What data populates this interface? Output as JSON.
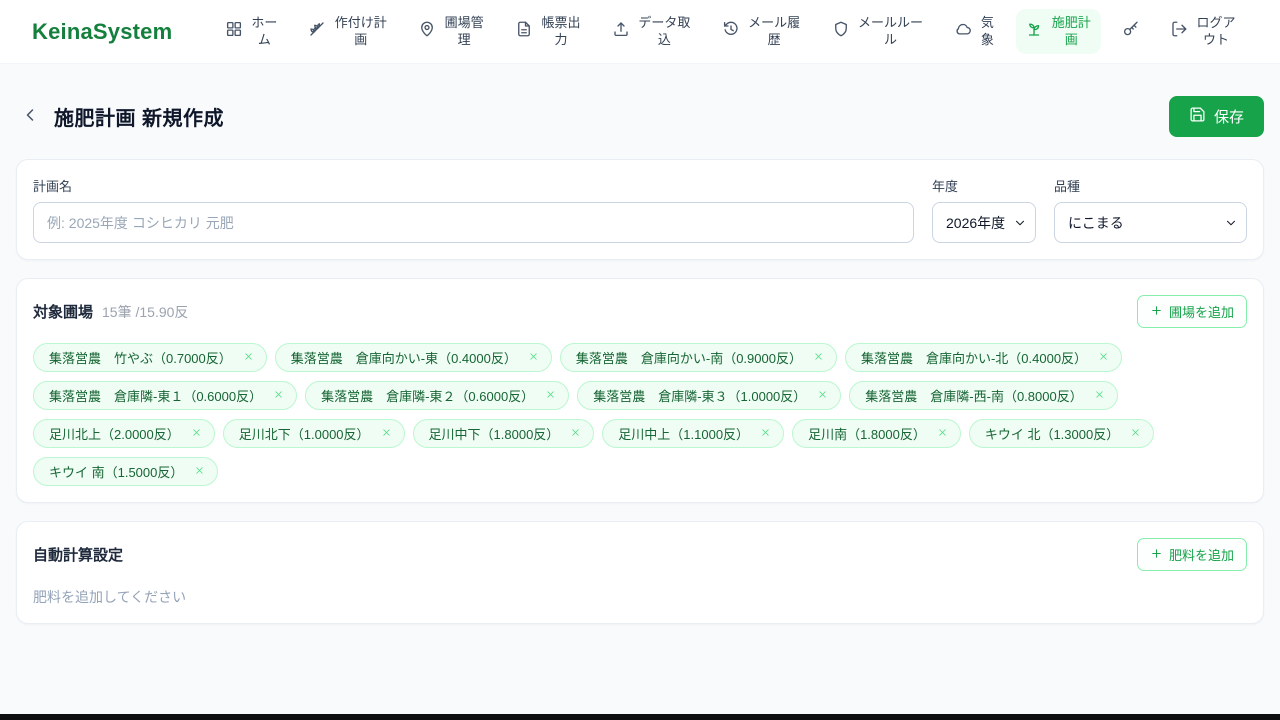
{
  "brand": "KeinaSystem",
  "nav": {
    "items": [
      {
        "label": "ホーム",
        "icon": "grid-icon"
      },
      {
        "label": "作付け計画",
        "icon": "wheat-icon"
      },
      {
        "label": "圃場管理",
        "icon": "map-pin-icon"
      },
      {
        "label": "帳票出力",
        "icon": "document-icon"
      },
      {
        "label": "データ取込",
        "icon": "upload-icon"
      },
      {
        "label": "メール履歴",
        "icon": "history-icon"
      },
      {
        "label": "メールルール",
        "icon": "shield-icon"
      },
      {
        "label": "気象",
        "icon": "cloud-icon"
      },
      {
        "label": "施肥計画",
        "icon": "seedling-icon",
        "active": true
      },
      {
        "label": "",
        "icon": "key-icon"
      },
      {
        "label": "ログアウト",
        "icon": "logout-icon"
      }
    ]
  },
  "page": {
    "title": "施肥計画 新規作成",
    "save_label": "保存"
  },
  "plan_form": {
    "name_label": "計画名",
    "name_placeholder": "例: 2025年度 コシヒカリ 元肥",
    "year_label": "年度",
    "year_value": "2026年度",
    "variety_label": "品種",
    "variety_value": "にこまる"
  },
  "fields_section": {
    "title": "対象圃場",
    "summary": "15筆 /15.90反",
    "add_button_label": "圃場を追加",
    "chips": [
      "集落営農　竹やぶ（0.7000反）",
      "集落営農　倉庫向かい-東（0.4000反）",
      "集落営農　倉庫向かい-南（0.9000反）",
      "集落営農　倉庫向かい-北（0.4000反）",
      "集落営農　倉庫隣-東１（0.6000反）",
      "集落営農　倉庫隣-東２（0.6000反）",
      "集落営農　倉庫隣-東３（1.0000反）",
      "集落営農　倉庫隣-西-南（0.8000反）",
      "足川北上（2.0000反）",
      "足川北下（1.0000反）",
      "足川中下（1.8000反）",
      "足川中上（1.1000反）",
      "足川南（1.8000反）",
      "キウイ 北（1.3000反）",
      "キウイ 南（1.5000反）"
    ]
  },
  "auto_calc_section": {
    "title": "自動計算設定",
    "add_button_label": "肥料を追加",
    "empty_text": "肥料を追加してください"
  },
  "colors": {
    "accent_green": "#16a34a",
    "brand_green": "#15803d",
    "chip_bg": "#f0fdf4",
    "chip_border": "#bbf7d0",
    "page_bg": "#f8fafc"
  }
}
